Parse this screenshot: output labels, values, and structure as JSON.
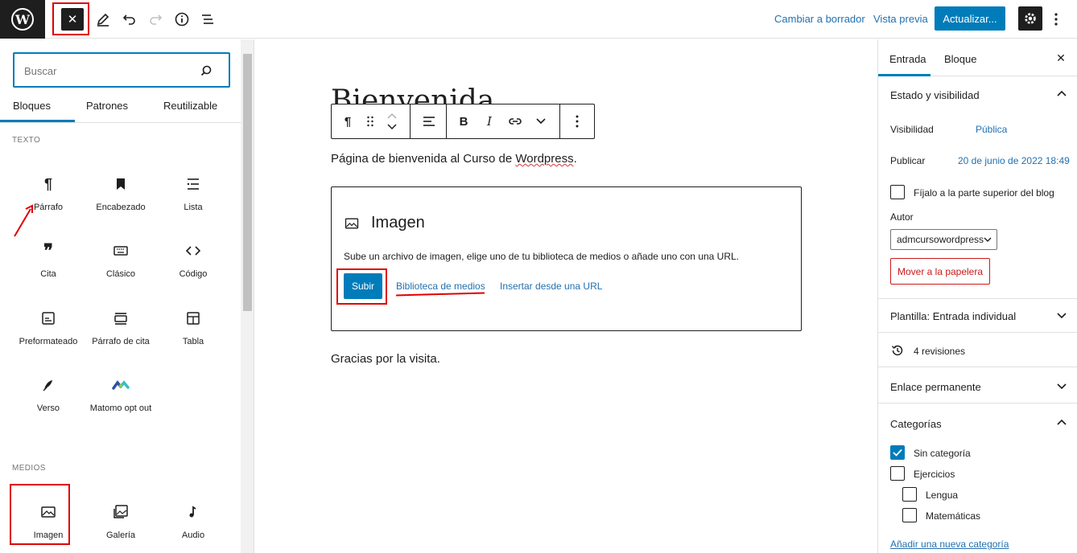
{
  "topbar": {
    "wp_logo": "W",
    "close_icon": "✕",
    "save_draft_label": "Cambiar a borrador",
    "preview_label": "Vista previa",
    "update_label": "Actualizar...",
    "icons": [
      "edit-icon",
      "undo-icon",
      "redo-icon",
      "info-icon",
      "list-view-icon",
      "gear-icon",
      "kebab-icon"
    ]
  },
  "inserter": {
    "search_placeholder": "Buscar",
    "tabs": [
      "Bloques",
      "Patrones",
      "Reutilizable"
    ],
    "active_tab": "Bloques",
    "sections": [
      {
        "title": "TEXTO",
        "blocks": [
          {
            "label": "Párrafo",
            "icon": "pilcrow-icon"
          },
          {
            "label": "Encabezado",
            "icon": "bookmark-icon"
          },
          {
            "label": "Lista",
            "icon": "list-icon"
          },
          {
            "label": "Cita",
            "icon": "quote-icon"
          },
          {
            "label": "Clásico",
            "icon": "keyboard-icon"
          },
          {
            "label": "Código",
            "icon": "code-icon"
          },
          {
            "label": "Preformateado",
            "icon": "preformatted-icon"
          },
          {
            "label": "Párrafo de cita",
            "icon": "pullquote-icon"
          },
          {
            "label": "Tabla",
            "icon": "table-icon"
          },
          {
            "label": "Verso",
            "icon": "feather-icon"
          },
          {
            "label": "Matomo opt out",
            "icon": "matomo-icon"
          }
        ]
      },
      {
        "title": "MEDIOS",
        "blocks": [
          {
            "label": "Imagen",
            "icon": "image-icon"
          },
          {
            "label": "Galería",
            "icon": "gallery-icon"
          },
          {
            "label": "Audio",
            "icon": "audio-icon"
          }
        ]
      }
    ]
  },
  "editor": {
    "title": "Bienvenida",
    "paragraph1_before": "Página de bienvenida al Curso de ",
    "paragraph1_misspelled": "Wordpress",
    "paragraph1_after": ".",
    "image_block": {
      "title": "Imagen",
      "description": "Sube un archivo de imagen, elige uno de tu biblioteca de medios o añade uno con una URL.",
      "upload_label": "Subir",
      "media_library_label": "Biblioteca de medios",
      "insert_url_label": "Insertar desde una URL"
    },
    "paragraph2": "Gracias por la visita.",
    "toolbar": {
      "paragraph_icon": "¶",
      "bold": "B",
      "italic": "I"
    }
  },
  "sidebar": {
    "tabs": [
      "Entrada",
      "Bloque"
    ],
    "active_tab": "Entrada",
    "status_panel": {
      "title": "Estado y visibilidad",
      "visibility_label": "Visibilidad",
      "visibility_value": "Pública",
      "publish_label": "Publicar",
      "publish_value": "20 de junio de 2022 18:49",
      "sticky_label": "Fíjalo a la parte superior del blog",
      "author_label": "Autor",
      "author_value": "admcursowordpress",
      "trash_label": "Mover a la papelera"
    },
    "template_panel": "Plantilla: Entrada individual",
    "revisions": "4 revisiones",
    "permalink_panel": "Enlace permanente",
    "categories_panel": {
      "title": "Categorías",
      "items": [
        {
          "label": "Sin categoría",
          "checked": true
        },
        {
          "label": "Ejercicios",
          "checked": false
        },
        {
          "label": "Lengua",
          "checked": false
        },
        {
          "label": "Matemáticas",
          "checked": false
        }
      ],
      "add_new_label": "Añadir una nueva categoría"
    }
  },
  "colors": {
    "accent": "#007cba",
    "link": "#2271b1",
    "dark": "#1e1e1e",
    "annotation": "#e00000",
    "danger": "#cc1818"
  }
}
